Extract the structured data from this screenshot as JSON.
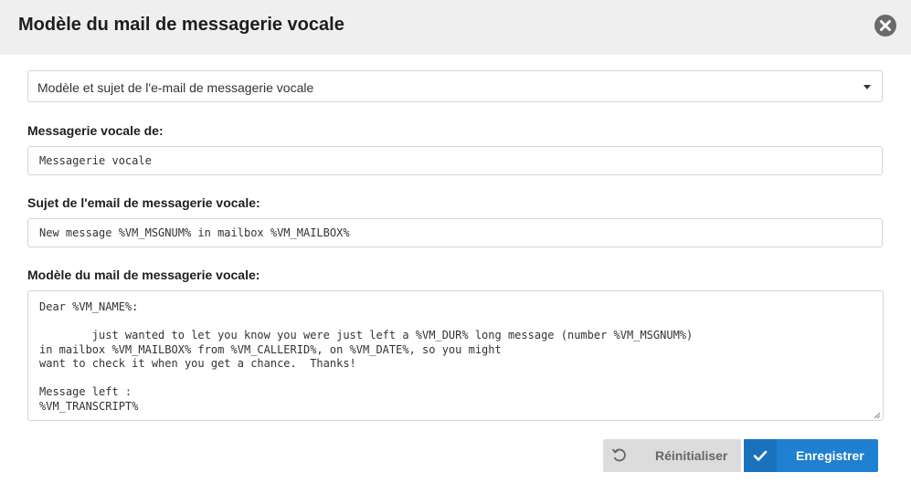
{
  "dialog": {
    "title": "Modèle du mail de messagerie vocale"
  },
  "template_select": {
    "selected": "Modèle et sujet de l'e-mail de messagerie vocale"
  },
  "from_field": {
    "label": "Messagerie vocale de:",
    "value": "Messagerie vocale"
  },
  "subject_field": {
    "label": "Sujet de l'email de messagerie vocale:",
    "value": "New message %VM_MSGNUM% in mailbox %VM_MAILBOX%"
  },
  "body_field": {
    "label": "Modèle du mail de messagerie vocale:",
    "value": "Dear %VM_NAME%:\n\n        just wanted to let you know you were just left a %VM_DUR% long message (number %VM_MSGNUM%)\nin mailbox %VM_MAILBOX% from %VM_CALLERID%, on %VM_DATE%, so you might\nwant to check it when you get a chance.  Thanks!\n\nMessage left :\n%VM_TRANSCRIPT%"
  },
  "actions": {
    "reset_label": "Réinitialiser",
    "save_label": "Enregistrer"
  },
  "colors": {
    "header_bg": "#efefef",
    "primary": "#1f7fd0",
    "secondary": "#dcdcdc"
  }
}
